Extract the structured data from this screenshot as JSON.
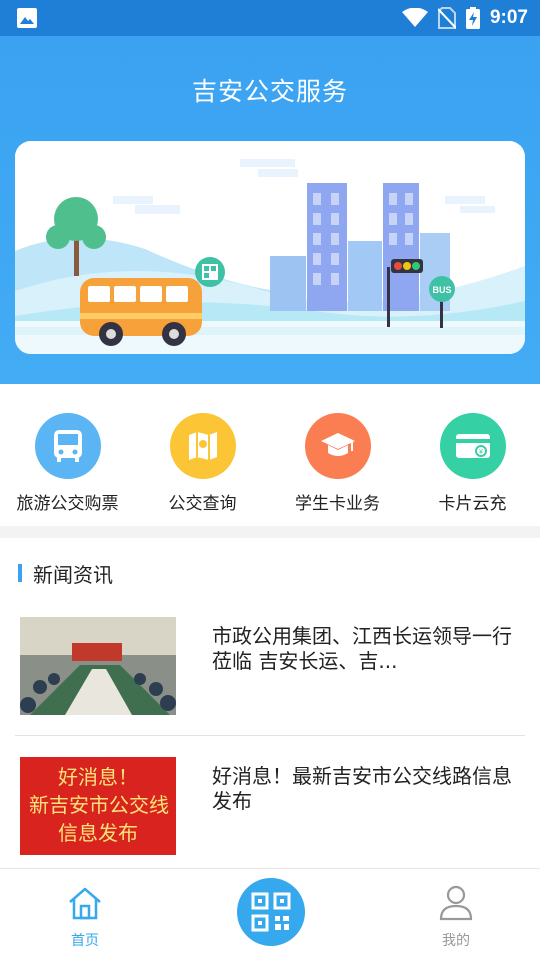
{
  "status_bar": {
    "time": "9:07",
    "icons": [
      "image-icon",
      "wifi-icon",
      "no-sim-icon",
      "battery-charging-icon"
    ]
  },
  "header": {
    "title": "吉安公交服务"
  },
  "banner": {
    "sign_text": "BUS"
  },
  "menu": [
    {
      "label": "旅游公交购票",
      "icon": "bus-icon",
      "color": "#5bb5f5"
    },
    {
      "label": "公交查询",
      "icon": "map-icon",
      "color": "#fbc536"
    },
    {
      "label": "学生卡业务",
      "icon": "graduation-cap-icon",
      "color": "#fb7e52"
    },
    {
      "label": "卡片云充",
      "icon": "card-recharge-icon",
      "color": "#36d0a5"
    }
  ],
  "news": {
    "section_title": "新闻资讯",
    "items": [
      {
        "headline": "市政公用集团、江西长运领导一行莅临 吉安长运、吉..."
      },
      {
        "headline": "好消息！最新吉安市公交线路信息发布",
        "image_text_line1": "好消息！",
        "image_text_line2": "新吉安市公交线",
        "image_text_line3": "信息发布"
      }
    ]
  },
  "bottom_nav": {
    "home_label": "首页",
    "mine_label": "我的",
    "active_color": "#35a8ee",
    "inactive_color": "#999999"
  }
}
